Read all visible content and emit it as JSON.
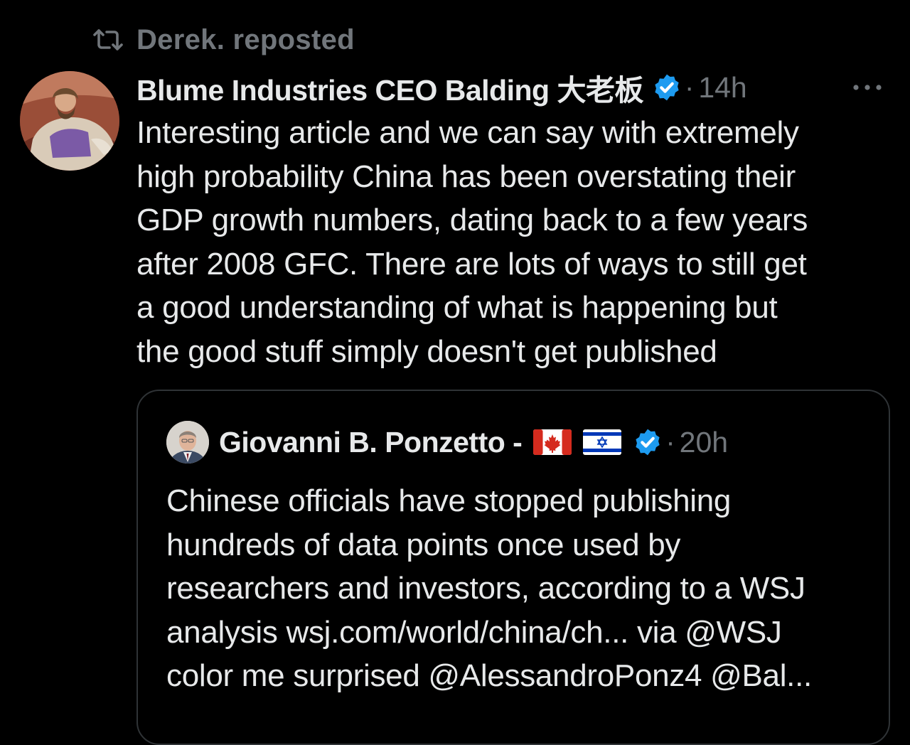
{
  "repost": {
    "icon": "repost-icon",
    "text": "Derek. reposted"
  },
  "tweet": {
    "author_name": "Blume Industries CEO Balding 大老板",
    "verified_icon": "verified-badge-icon",
    "separator": "·",
    "time": "14h",
    "more_icon": "more-options-icon",
    "body": "Interesting article and we can say with extremely\nhigh probability China has been overstating their\nGDP growth numbers, dating back to a few years\nafter 2008 GFC. There are lots of ways to still get\na good understanding of what is happening but\nthe good stuff simply doesn't get published"
  },
  "quote": {
    "author_name": "Giovanni B. Ponzetto -",
    "flags": [
      "canada-flag-icon",
      "israel-flag-icon"
    ],
    "verified_icon": "verified-badge-icon",
    "separator": "·",
    "time": "20h",
    "body": "Chinese officials have stopped publishing\nhundreds of data points once used by\nresearchers and investors, according to a WSJ\nanalysis wsj.com/world/china/ch... via @WSJ\ncolor me surprised @AlessandroPonz4 @Bal..."
  },
  "colors": {
    "background": "#000000",
    "text_primary": "#e7e9ea",
    "text_secondary": "#71767b",
    "verified_blue": "#1d9bf0",
    "card_border": "#2f3336"
  }
}
